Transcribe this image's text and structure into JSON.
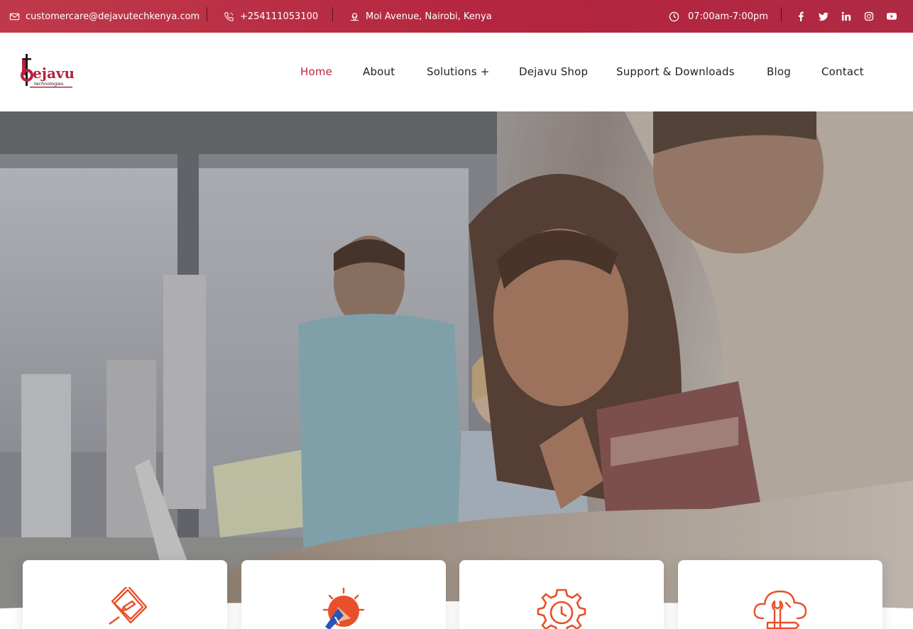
{
  "topbar": {
    "email": "customercare@dejavutechkenya.com",
    "phone": "+254111053100",
    "address": "Moi Avenue, Nairobi, Kenya",
    "hours": "07:00am-7:00pm",
    "icons": [
      "mail-icon",
      "phone-icon",
      "location-icon",
      "clock-icon"
    ],
    "social": [
      "facebook-icon",
      "twitter-icon",
      "linkedin-icon",
      "instagram-icon",
      "youtube-icon"
    ]
  },
  "logo": {
    "text_main": "ejavu",
    "text_sub": "technologies"
  },
  "nav": {
    "items": [
      {
        "label": "Home",
        "active": true
      },
      {
        "label": "About",
        "active": false
      },
      {
        "label": "Solutions +",
        "active": false
      },
      {
        "label": "Dejavu Shop",
        "active": false
      },
      {
        "label": "Support & Downloads",
        "active": false
      },
      {
        "label": "Blog",
        "active": false
      },
      {
        "label": "Contact",
        "active": false
      }
    ]
  },
  "cards": [
    {
      "icon": "pen-document-icon"
    },
    {
      "icon": "idea-lightbulb-icon"
    },
    {
      "icon": "gear-clock-icon"
    },
    {
      "icon": "cloud-tools-icon"
    }
  ],
  "colors": {
    "brand": "#b8233c",
    "accent_orange": "#e8502a",
    "topbar": "#b3243e"
  }
}
